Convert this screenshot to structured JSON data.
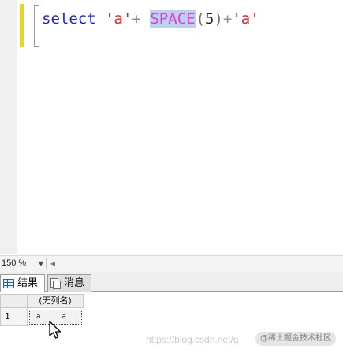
{
  "editor": {
    "tokens": {
      "keyword": "select",
      "str1": "'a'",
      "plus1": "+",
      "function": "SPACE",
      "open_paren": "(",
      "arg": "5",
      "close_paren": ")",
      "plus2": "+",
      "str2": "'a'"
    }
  },
  "statusbar": {
    "zoom": "150 %",
    "zoom_dropdown_icon": "dropdown-arrow-icon",
    "scroll_left_icon": "scroll-left-arrow-icon"
  },
  "tabs": [
    {
      "label": "结果",
      "icon": "grid-icon",
      "active": true
    },
    {
      "label": "消息",
      "icon": "messages-icon",
      "active": false
    }
  ],
  "grid": {
    "columns": [
      "(无列名)"
    ],
    "rows": [
      {
        "number": "1",
        "cells": [
          "a     a"
        ]
      }
    ]
  },
  "watermark": {
    "url": "https://blog.csdn.net/q",
    "badge": "@稀土掘金技术社区"
  },
  "colors": {
    "keyword": "#1f1fd6",
    "string": "#e02020",
    "function": "#e83cc8",
    "selection": "#b9d2f3",
    "change_bar": "#f0d418"
  }
}
